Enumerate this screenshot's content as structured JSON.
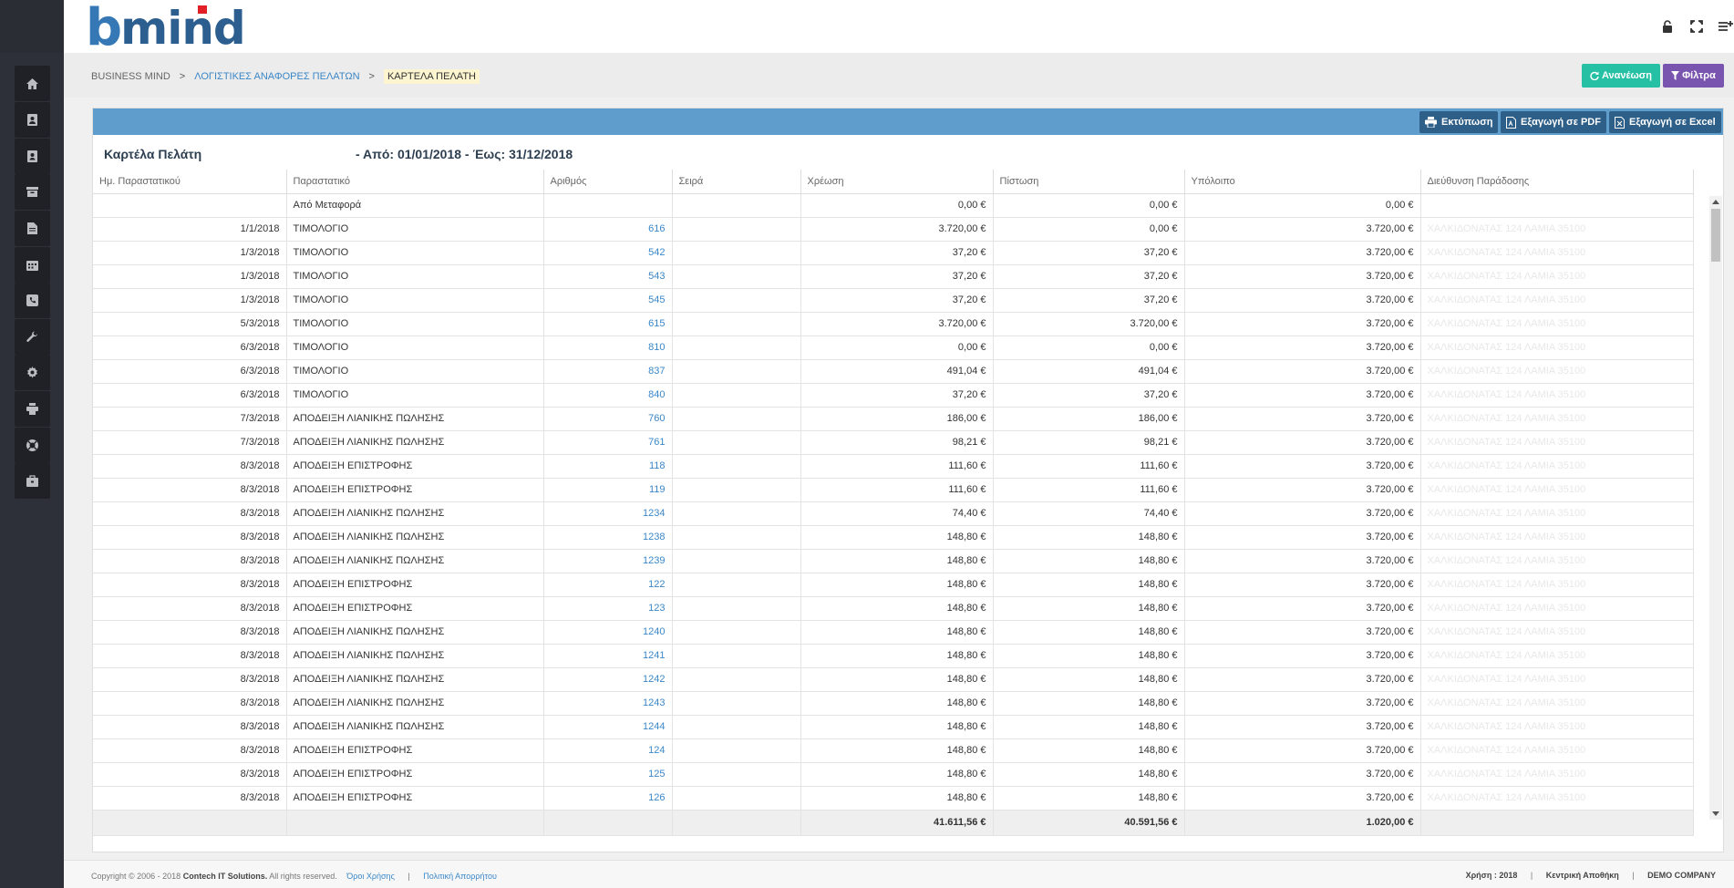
{
  "app": {
    "logo_b": "b",
    "logo_mind": "mind"
  },
  "breadcrumb": {
    "items": [
      "BUSINESS MIND",
      "ΛΟΓΙΣΤΙΚΕΣ ΑΝΑΦΟΡΕΣ ΠΕΛΑΤΩΝ",
      "ΚΑΡΤΕΛΑ ΠΕΛΑΤΗ"
    ],
    "separator": ">"
  },
  "actions": {
    "refresh_label": "Ανανέωση",
    "filter_label": "Φίλτρα"
  },
  "toolbar": {
    "print_label": "Εκτύπωση",
    "pdf_label": "Εξαγωγή σε PDF",
    "excel_label": "Εξαγωγή σε Excel"
  },
  "report": {
    "title": "Καρτέλα Πελάτη",
    "range": "- Από: 01/01/2018 - Έως: 31/12/2018"
  },
  "table": {
    "columns": [
      "Ημ. Παραστατικού",
      "Παραστατικό",
      "Αριθμός",
      "Σειρά",
      "Χρέωση",
      "Πίστωση",
      "Υπόλοιπο",
      "Διεύθυνση Παράδοσης"
    ],
    "rows": [
      [
        "",
        "Από Μεταφορά",
        "",
        "",
        "0,00 €",
        "0,00 €",
        "0,00 €",
        ""
      ],
      [
        "1/1/2018",
        "ΤΙΜΟΛΟΓΙΟ",
        "616",
        "",
        "3.720,00 €",
        "0,00 €",
        "3.720,00 €",
        "ΧΑΛΚΙΔΟΝΑΤΑΣ 124 ΛΑΜΙΑ 35100"
      ],
      [
        "1/3/2018",
        "ΤΙΜΟΛΟΓΙΟ",
        "542",
        "",
        "37,20 €",
        "37,20 €",
        "3.720,00 €",
        "ΧΑΛΚΙΔΟΝΑΤΑΣ 124 ΛΑΜΙΑ 35100"
      ],
      [
        "1/3/2018",
        "ΤΙΜΟΛΟΓΙΟ",
        "543",
        "",
        "37,20 €",
        "37,20 €",
        "3.720,00 €",
        "ΧΑΛΚΙΔΟΝΑΤΑΣ 124 ΛΑΜΙΑ 35100"
      ],
      [
        "1/3/2018",
        "ΤΙΜΟΛΟΓΙΟ",
        "545",
        "",
        "37,20 €",
        "37,20 €",
        "3.720,00 €",
        "ΧΑΛΚΙΔΟΝΑΤΑΣ 124 ΛΑΜΙΑ 35100"
      ],
      [
        "5/3/2018",
        "ΤΙΜΟΛΟΓΙΟ",
        "615",
        "",
        "3.720,00 €",
        "3.720,00 €",
        "3.720,00 €",
        "ΧΑΛΚΙΔΟΝΑΤΑΣ 124 ΛΑΜΙΑ 35100"
      ],
      [
        "6/3/2018",
        "ΤΙΜΟΛΟΓΙΟ",
        "810",
        "",
        "0,00 €",
        "0,00 €",
        "3.720,00 €",
        "ΧΑΛΚΙΔΟΝΑΤΑΣ 124 ΛΑΜΙΑ 35100"
      ],
      [
        "6/3/2018",
        "ΤΙΜΟΛΟΓΙΟ",
        "837",
        "",
        "491,04 €",
        "491,04 €",
        "3.720,00 €",
        "ΧΑΛΚΙΔΟΝΑΤΑΣ 124 ΛΑΜΙΑ 35100"
      ],
      [
        "6/3/2018",
        "ΤΙΜΟΛΟΓΙΟ",
        "840",
        "",
        "37,20 €",
        "37,20 €",
        "3.720,00 €",
        "ΧΑΛΚΙΔΟΝΑΤΑΣ 124 ΛΑΜΙΑ 35100"
      ],
      [
        "7/3/2018",
        "ΑΠΟΔΕΙΞΗ ΛΙΑΝΙΚΗΣ ΠΩΛΗΣΗΣ",
        "760",
        "",
        "186,00 €",
        "186,00 €",
        "3.720,00 €",
        "ΧΑΛΚΙΔΟΝΑΤΑΣ 124 ΛΑΜΙΑ 35100"
      ],
      [
        "7/3/2018",
        "ΑΠΟΔΕΙΞΗ ΛΙΑΝΙΚΗΣ ΠΩΛΗΣΗΣ",
        "761",
        "",
        "98,21 €",
        "98,21 €",
        "3.720,00 €",
        "ΧΑΛΚΙΔΟΝΑΤΑΣ 124 ΛΑΜΙΑ 35100"
      ],
      [
        "8/3/2018",
        "ΑΠΟΔΕΙΞΗ ΕΠΙΣΤΡΟΦΗΣ",
        "118",
        "",
        "111,60 €",
        "111,60 €",
        "3.720,00 €",
        "ΧΑΛΚΙΔΟΝΑΤΑΣ 124 ΛΑΜΙΑ 35100"
      ],
      [
        "8/3/2018",
        "ΑΠΟΔΕΙΞΗ ΕΠΙΣΤΡΟΦΗΣ",
        "119",
        "",
        "111,60 €",
        "111,60 €",
        "3.720,00 €",
        "ΧΑΛΚΙΔΟΝΑΤΑΣ 124 ΛΑΜΙΑ 35100"
      ],
      [
        "8/3/2018",
        "ΑΠΟΔΕΙΞΗ ΛΙΑΝΙΚΗΣ ΠΩΛΗΣΗΣ",
        "1234",
        "",
        "74,40 €",
        "74,40 €",
        "3.720,00 €",
        "ΧΑΛΚΙΔΟΝΑΤΑΣ 124 ΛΑΜΙΑ 35100"
      ],
      [
        "8/3/2018",
        "ΑΠΟΔΕΙΞΗ ΛΙΑΝΙΚΗΣ ΠΩΛΗΣΗΣ",
        "1238",
        "",
        "148,80 €",
        "148,80 €",
        "3.720,00 €",
        "ΧΑΛΚΙΔΟΝΑΤΑΣ 124 ΛΑΜΙΑ 35100"
      ],
      [
        "8/3/2018",
        "ΑΠΟΔΕΙΞΗ ΛΙΑΝΙΚΗΣ ΠΩΛΗΣΗΣ",
        "1239",
        "",
        "148,80 €",
        "148,80 €",
        "3.720,00 €",
        "ΧΑΛΚΙΔΟΝΑΤΑΣ 124 ΛΑΜΙΑ 35100"
      ],
      [
        "8/3/2018",
        "ΑΠΟΔΕΙΞΗ ΕΠΙΣΤΡΟΦΗΣ",
        "122",
        "",
        "148,80 €",
        "148,80 €",
        "3.720,00 €",
        "ΧΑΛΚΙΔΟΝΑΤΑΣ 124 ΛΑΜΙΑ 35100"
      ],
      [
        "8/3/2018",
        "ΑΠΟΔΕΙΞΗ ΕΠΙΣΤΡΟΦΗΣ",
        "123",
        "",
        "148,80 €",
        "148,80 €",
        "3.720,00 €",
        "ΧΑΛΚΙΔΟΝΑΤΑΣ 124 ΛΑΜΙΑ 35100"
      ],
      [
        "8/3/2018",
        "ΑΠΟΔΕΙΞΗ ΛΙΑΝΙΚΗΣ ΠΩΛΗΣΗΣ",
        "1240",
        "",
        "148,80 €",
        "148,80 €",
        "3.720,00 €",
        "ΧΑΛΚΙΔΟΝΑΤΑΣ 124 ΛΑΜΙΑ 35100"
      ],
      [
        "8/3/2018",
        "ΑΠΟΔΕΙΞΗ ΛΙΑΝΙΚΗΣ ΠΩΛΗΣΗΣ",
        "1241",
        "",
        "148,80 €",
        "148,80 €",
        "3.720,00 €",
        "ΧΑΛΚΙΔΟΝΑΤΑΣ 124 ΛΑΜΙΑ 35100"
      ],
      [
        "8/3/2018",
        "ΑΠΟΔΕΙΞΗ ΛΙΑΝΙΚΗΣ ΠΩΛΗΣΗΣ",
        "1242",
        "",
        "148,80 €",
        "148,80 €",
        "3.720,00 €",
        "ΧΑΛΚΙΔΟΝΑΤΑΣ 124 ΛΑΜΙΑ 35100"
      ],
      [
        "8/3/2018",
        "ΑΠΟΔΕΙΞΗ ΛΙΑΝΙΚΗΣ ΠΩΛΗΣΗΣ",
        "1243",
        "",
        "148,80 €",
        "148,80 €",
        "3.720,00 €",
        "ΧΑΛΚΙΔΟΝΑΤΑΣ 124 ΛΑΜΙΑ 35100"
      ],
      [
        "8/3/2018",
        "ΑΠΟΔΕΙΞΗ ΛΙΑΝΙΚΗΣ ΠΩΛΗΣΗΣ",
        "1244",
        "",
        "148,80 €",
        "148,80 €",
        "3.720,00 €",
        "ΧΑΛΚΙΔΟΝΑΤΑΣ 124 ΛΑΜΙΑ 35100"
      ],
      [
        "8/3/2018",
        "ΑΠΟΔΕΙΞΗ ΕΠΙΣΤΡΟΦΗΣ",
        "124",
        "",
        "148,80 €",
        "148,80 €",
        "3.720,00 €",
        "ΧΑΛΚΙΔΟΝΑΤΑΣ 124 ΛΑΜΙΑ 35100"
      ],
      [
        "8/3/2018",
        "ΑΠΟΔΕΙΞΗ ΕΠΙΣΤΡΟΦΗΣ",
        "125",
        "",
        "148,80 €",
        "148,80 €",
        "3.720,00 €",
        "ΧΑΛΚΙΔΟΝΑΤΑΣ 124 ΛΑΜΙΑ 35100"
      ],
      [
        "8/3/2018",
        "ΑΠΟΔΕΙΞΗ ΕΠΙΣΤΡΟΦΗΣ",
        "126",
        "",
        "148,80 €",
        "148,80 €",
        "3.720,00 €",
        "ΧΑΛΚΙΔΟΝΑΤΑΣ 124 ΛΑΜΙΑ 35100"
      ]
    ],
    "totals": [
      "",
      "",
      "",
      "",
      "41.611,56 €",
      "40.591,56 €",
      "1.020,00 €",
      ""
    ]
  },
  "sidebar": {
    "icons": [
      "home-icon",
      "contacts-book-icon",
      "address-card-icon",
      "archive-icon",
      "document-icon",
      "calendar-icon",
      "phone-icon",
      "wrench-icon",
      "gear-icon",
      "printer-icon",
      "support-lifebuoy-icon",
      "toolbox-icon"
    ]
  },
  "header_icons": [
    "lock-icon",
    "fullscreen-icon",
    "menu-add-icon"
  ],
  "footer": {
    "copyright": "Copyright © 2006 - 2018",
    "company": "Contech IT Solutions.",
    "rights": "All rights reserved.",
    "terms": "Όροι Χρήσης",
    "privacy": "Πολιτική Απορρήτου",
    "year": "Χρήση : 2018",
    "warehouse": "Κεντρική Αποθήκη",
    "org": "DEMO COMPANY"
  },
  "colors": {
    "accent": "#5f9dcc",
    "refresh": "#26c0a5",
    "filter": "#7a55b0",
    "link": "#3a87c8",
    "sidebar": "#2d3038"
  }
}
